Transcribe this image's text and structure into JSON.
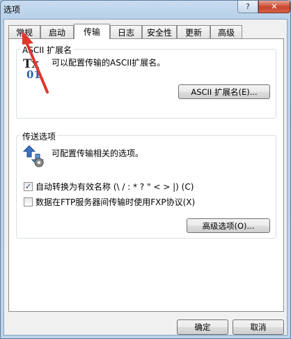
{
  "window": {
    "title": "选项",
    "help_label": "?",
    "close_label": "✕"
  },
  "tabs": [
    {
      "label": "常规"
    },
    {
      "label": "启动"
    },
    {
      "label": "传输"
    },
    {
      "label": "日志"
    },
    {
      "label": "安全性"
    },
    {
      "label": "更新"
    },
    {
      "label": "高级"
    }
  ],
  "ascii_group": {
    "legend": "ASCII 扩展名",
    "description": "可以配置传输的ASCII扩展名。",
    "button_label": "ASCII 扩展名(E)..."
  },
  "transfer_group": {
    "legend": "传送选项",
    "description": "可配置传输相关的选项。",
    "option1": {
      "label": "自动转换为有效名称 (\\ / : * ? \" < > |) (C)",
      "checked": true
    },
    "option2": {
      "label": "数据在FTP服务器间传输时使用FXP协议(X)",
      "checked": false
    },
    "advanced_button_label": "高级选项(O)..."
  },
  "footer": {
    "ok_label": "确定",
    "cancel_label": "取消"
  },
  "colors": {
    "accent": "#e0362b",
    "icon_blue": "#2b5fa8"
  }
}
